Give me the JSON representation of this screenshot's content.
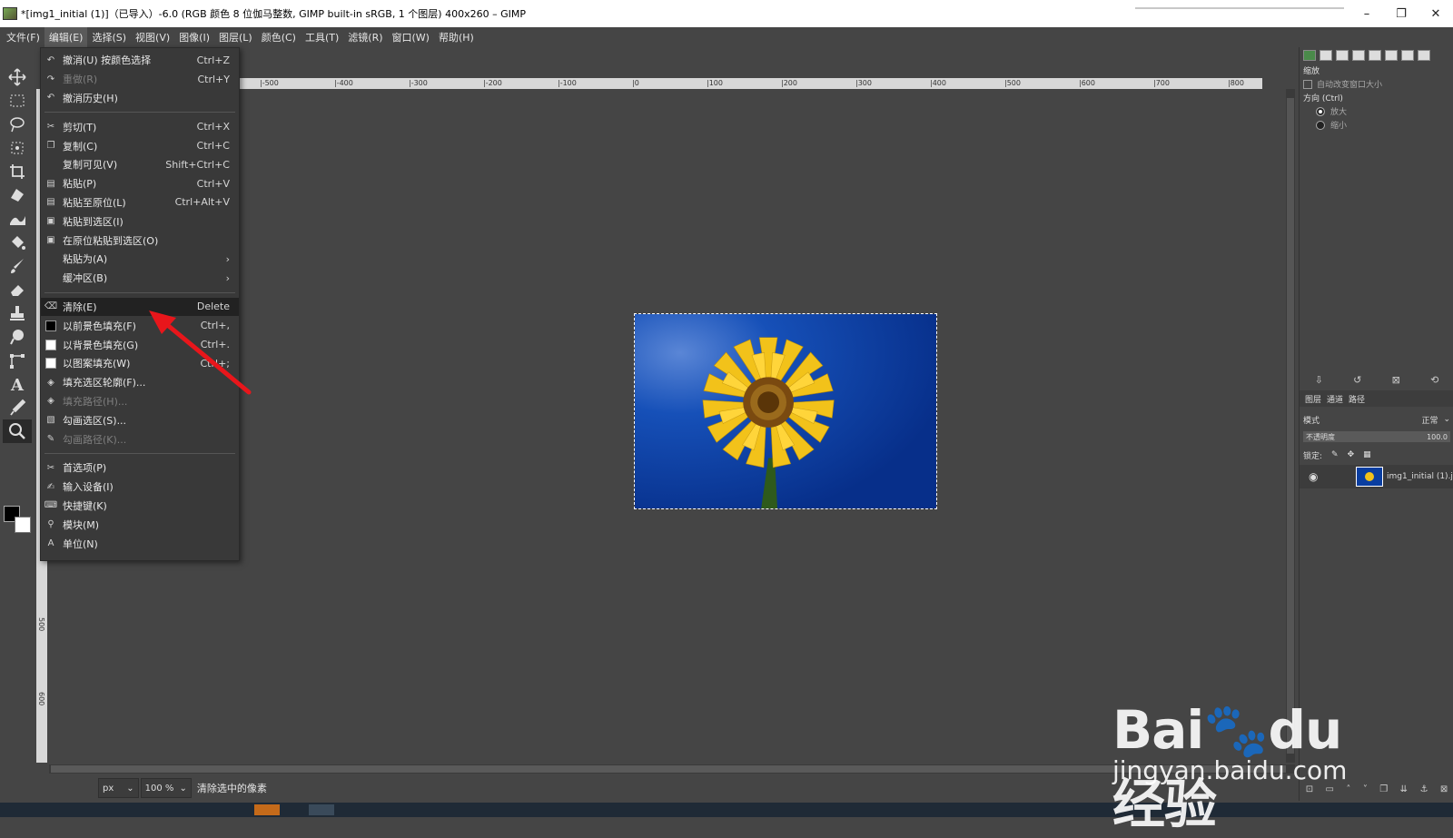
{
  "window": {
    "title": "*[img1_initial (1)]（已导入）-6.0 (RGB 颜色 8 位伽马整数, GIMP built-in sRGB, 1 个图层) 400x260 – GIMP",
    "minimize": "–",
    "maximize": "❐",
    "close": "✕"
  },
  "menubar": [
    "文件(F)",
    "编辑(E)",
    "选择(S)",
    "视图(V)",
    "图像(I)",
    "图层(L)",
    "颜色(C)",
    "工具(T)",
    "滤镜(R)",
    "窗口(W)",
    "帮助(H)"
  ],
  "edit_menu": {
    "items": [
      {
        "icon": "undo-icon",
        "glyph": "↶",
        "label": "撤消(U) 按颜色选择",
        "shortcut": "Ctrl+Z",
        "disabled": false
      },
      {
        "icon": "redo-icon",
        "glyph": "↷",
        "label": "重做(R)",
        "shortcut": "Ctrl+Y",
        "disabled": true
      },
      {
        "icon": "undo-history-icon",
        "glyph": "↶",
        "label": "撤消历史(H)",
        "shortcut": "",
        "disabled": false
      },
      {
        "sep": true
      },
      {
        "icon": "scissors-icon",
        "glyph": "✂",
        "label": "剪切(T)",
        "shortcut": "Ctrl+X",
        "disabled": false
      },
      {
        "icon": "copy-icon",
        "glyph": "❐",
        "label": "复制(C)",
        "shortcut": "Ctrl+C",
        "disabled": false
      },
      {
        "icon": "",
        "glyph": "",
        "label": "复制可见(V)",
        "shortcut": "Shift+Ctrl+C",
        "disabled": false
      },
      {
        "icon": "paste-icon",
        "glyph": "▤",
        "label": "粘贴(P)",
        "shortcut": "Ctrl+V",
        "disabled": false
      },
      {
        "icon": "paste-in-place-icon",
        "glyph": "▤",
        "label": "粘贴至原位(L)",
        "shortcut": "Ctrl+Alt+V",
        "disabled": false
      },
      {
        "icon": "paste-into-icon",
        "glyph": "▣",
        "label": "粘贴到选区(I)",
        "shortcut": "",
        "disabled": false
      },
      {
        "icon": "paste-into-in-place-icon",
        "glyph": "▣",
        "label": "在原位粘贴到选区(O)",
        "shortcut": "",
        "disabled": false
      },
      {
        "icon": "",
        "glyph": "",
        "label": "粘贴为(A)",
        "shortcut": "",
        "submenu": true,
        "disabled": false
      },
      {
        "icon": "",
        "glyph": "",
        "label": "缓冲区(B)",
        "shortcut": "",
        "submenu": true,
        "disabled": false
      },
      {
        "sep": true
      },
      {
        "icon": "clear-icon",
        "glyph": "⌫",
        "label": "清除(E)",
        "shortcut": "Delete",
        "disabled": false,
        "highlighted": true
      },
      {
        "icon": "fg-fill-icon",
        "swatch": "#000000",
        "label": "以前景色填充(F)",
        "shortcut": "Ctrl+,",
        "disabled": false
      },
      {
        "icon": "bg-fill-icon",
        "swatch": "#ffffff",
        "label": "以背景色填充(G)",
        "shortcut": "Ctrl+.",
        "disabled": false
      },
      {
        "icon": "pattern-fill-icon",
        "swatch": "#ffffff",
        "label": "以图案填充(W)",
        "shortcut": "Ctrl+;",
        "disabled": false
      },
      {
        "icon": "stroke-selection-icon",
        "glyph": "◈",
        "label": "填充选区轮廓(F)...",
        "shortcut": "",
        "disabled": false
      },
      {
        "icon": "fill-path-icon",
        "glyph": "◈",
        "label": "填充路径(H)...",
        "shortcut": "",
        "disabled": true
      },
      {
        "icon": "stroke-select-icon",
        "glyph": "▧",
        "label": "勾画选区(S)...",
        "shortcut": "",
        "disabled": false
      },
      {
        "icon": "stroke-path-icon",
        "glyph": "✎",
        "label": "勾画路径(K)...",
        "shortcut": "",
        "disabled": true
      },
      {
        "sep": true
      },
      {
        "icon": "preferences-icon",
        "glyph": "✂",
        "label": "首选项(P)",
        "shortcut": "",
        "disabled": false
      },
      {
        "icon": "input-devices-icon",
        "glyph": "✍",
        "label": "输入设备(I)",
        "shortcut": "",
        "disabled": false
      },
      {
        "icon": "keyboard-shortcuts-icon",
        "glyph": "⌨",
        "label": "快捷键(K)",
        "shortcut": "",
        "disabled": false
      },
      {
        "icon": "modules-icon",
        "glyph": "⚲",
        "label": "模块(M)",
        "shortcut": "",
        "disabled": false
      },
      {
        "icon": "units-icon",
        "glyph": "A",
        "label": "单位(N)",
        "shortcut": "",
        "disabled": false
      }
    ]
  },
  "ruler": {
    "h_labels": [
      "|-500",
      "|-400",
      "|-300",
      "|-200",
      "|-100",
      "|0",
      "|100",
      "|200",
      "|300",
      "|400",
      "|500",
      "|600",
      "|700",
      "|800"
    ],
    "v_labels": [
      "500",
      "600",
      "700"
    ]
  },
  "statusbar": {
    "unit": "px",
    "zoom": "100 %",
    "message": "清除选中的像素"
  },
  "tool_options": {
    "title": "缩放",
    "auto_resize": "自动改变窗口大小",
    "direction_label": "方向 (Ctrl)",
    "zoom_in": "放大",
    "zoom_out": "缩小"
  },
  "layers_panel": {
    "tabs": [
      "图层",
      "通道",
      "路径"
    ],
    "mode_label": "模式",
    "mode_value": "正常",
    "opacity_label": "不透明度",
    "opacity_value": "100.0",
    "lock_label": "锁定:",
    "layer_name": "img1_initial (1).j"
  },
  "watermark": {
    "logo": "Bai🐾du 经验",
    "url": "jingyan.baidu.com"
  },
  "colors": {
    "menu_bg": "#393939",
    "highlight": "#222222",
    "annotation_arrow": "#e8161b",
    "sky": "#0a3ea0",
    "petal": "#f2c21a"
  }
}
